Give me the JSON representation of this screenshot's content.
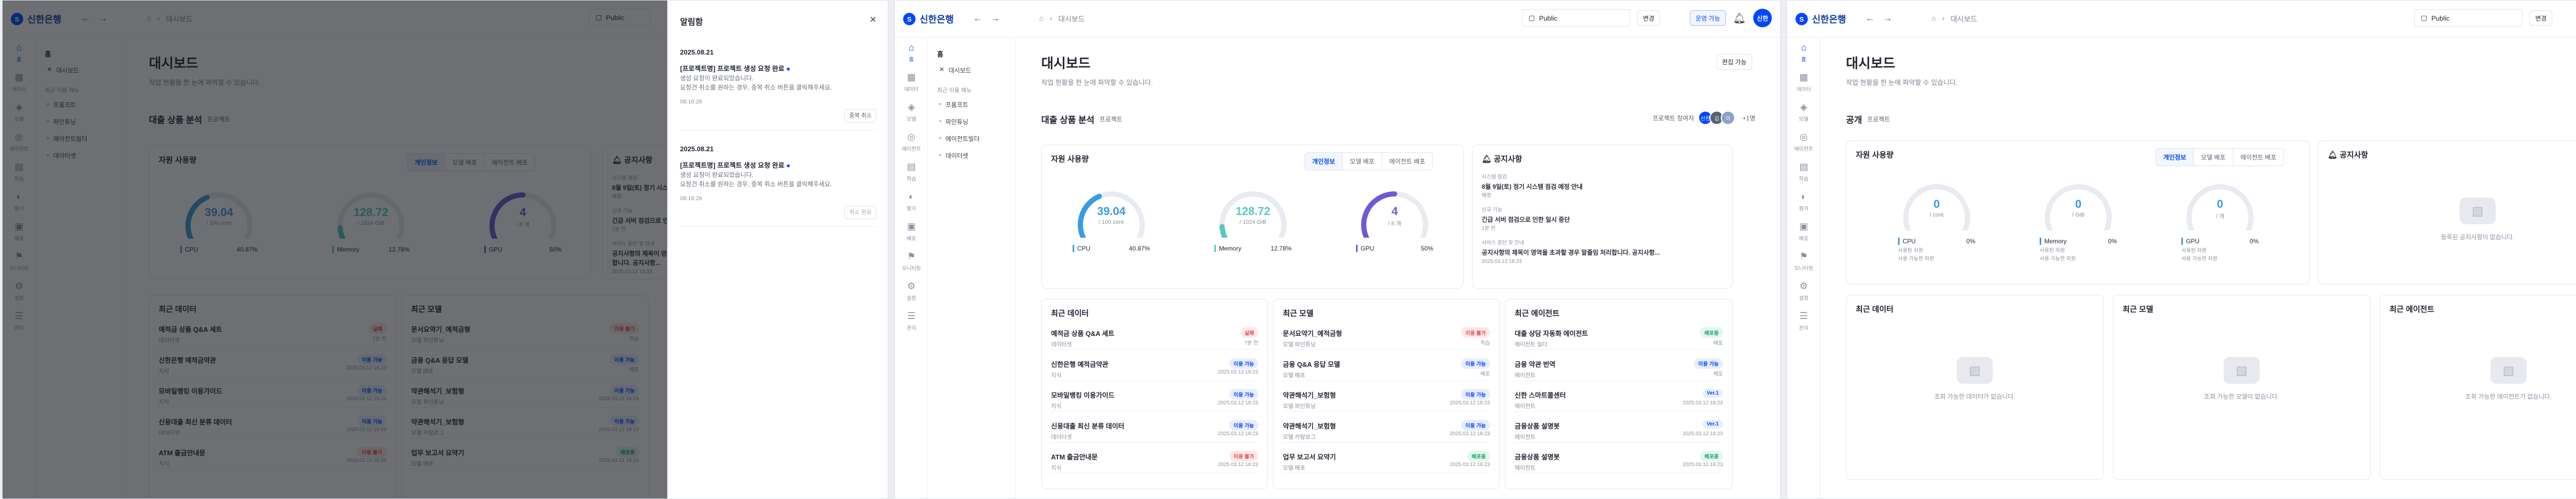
{
  "brand": {
    "name": "신한은행",
    "mark": "S"
  },
  "nav": {
    "back": "←",
    "forward": "→"
  },
  "breadcrumb": [
    "⌂",
    "›",
    "대시보드"
  ],
  "header": {
    "project_select": "Public",
    "tag_button": "변경",
    "mode_badge": "운영 가능",
    "user_initials": "신한"
  },
  "rail": [
    {
      "icon": "⌂",
      "label": "홈"
    },
    {
      "icon": "▦",
      "label": "데이터"
    },
    {
      "icon": "◈",
      "label": "모델"
    },
    {
      "icon": "◎",
      "label": "에이전트"
    },
    {
      "icon": "▤",
      "label": "학습"
    },
    {
      "icon": "◐",
      "label": "평가"
    },
    {
      "icon": "▣",
      "label": "배포"
    },
    {
      "icon": "⚑",
      "label": "모니터링"
    },
    {
      "icon": "⚙",
      "label": "설정"
    },
    {
      "icon": "☰",
      "label": "관리"
    }
  ],
  "submenu": {
    "home": "홈",
    "dashboard": "대시보드",
    "section": "최근 이용 메뉴",
    "items": [
      "프롬프트",
      "파인튜닝",
      "에이전트빌더",
      "데이터셋"
    ]
  },
  "page": {
    "title": "대시보드",
    "subtitle": "작업 현황을 한 눈에 파악할 수 있습니다.",
    "edit_button": "편집 가능",
    "section_title": "대출 상품 분석",
    "section_tag": "프로젝트",
    "section_title_empty": "공개",
    "members_label": "프로젝트 참여자",
    "members_more": "+1명",
    "members": [
      "신한",
      "김",
      "이"
    ]
  },
  "resources": {
    "title": "자원 사용량",
    "tabs": [
      "개인정보",
      "모델 배포",
      "에이전트 배포"
    ],
    "gauges": [
      {
        "name": "CPU",
        "value": "39.04",
        "unit": "/ 100 core",
        "pct": "40.87%",
        "ratio": 0.41,
        "color": "#3a9be0"
      },
      {
        "name": "Memory",
        "value": "128.72",
        "unit": "/ 1024 GiB",
        "pct": "12.78%",
        "ratio": 0.13,
        "color": "#56c8be"
      },
      {
        "name": "GPU",
        "value": "4",
        "unit": "/ 8 개",
        "pct": "50%",
        "ratio": 0.5,
        "color": "#6b5bd6"
      }
    ],
    "gauges_empty": [
      {
        "name": "CPU",
        "value": "0",
        "unit": "/ core",
        "pct": "0%"
      },
      {
        "name": "Memory",
        "value": "0",
        "unit": "/ GiB",
        "pct": "0%"
      },
      {
        "name": "GPU",
        "value": "0",
        "unit": "/ 개",
        "pct": "0%"
      }
    ],
    "sub_used": "사용된 자원",
    "sub_avail": "사용 가능한 자원"
  },
  "notices": {
    "title": "공지사항",
    "items": [
      {
        "section": "시스템 점검",
        "title": "8월 9일(토) 정기 시스템 점검 예정 안내",
        "date": "예정"
      },
      {
        "section": "신규 기능",
        "title": "긴급 서버 점검으로 인한 일시 중단",
        "date": "1분 전"
      },
      {
        "section": "서비스 중단 및 안내",
        "title": "공지사항의 제목이 영역을 초과할 경우 말줄임 처리합니다. 공지사항...",
        "date": "2025.03.12 18:23"
      }
    ],
    "empty": "등록된 공지사항이 없습니다."
  },
  "recent_data": {
    "title": "최근 데이터",
    "items": [
      {
        "name": "예적금 상품 Q&A 세트",
        "sub": "데이터셋",
        "badge": "실패",
        "tone": "red",
        "date": "7분 전"
      },
      {
        "name": "신한은행 예적금약관",
        "sub": "지식",
        "badge": "이용 가능",
        "tone": "blue",
        "date": "2025.03.12 18:23"
      },
      {
        "name": "모바일뱅킹 이용가이드",
        "sub": "지식",
        "badge": "이용 가능",
        "tone": "blue",
        "date": "2025.03.12 18:23"
      },
      {
        "name": "신용대출 최신 분류 데이터",
        "sub": "데이터셋",
        "badge": "이용 가능",
        "tone": "blue",
        "date": "2025.03.12 18:23"
      },
      {
        "name": "ATM 출금안내문",
        "sub": "지식",
        "badge": "이용 불가",
        "tone": "red",
        "date": "2025.03.12 18:23"
      }
    ],
    "empty": "조회 가능한 데이터가 없습니다."
  },
  "recent_models": {
    "title": "최근 모델",
    "items": [
      {
        "name": "문서요약기_예적금형",
        "sub": "모델 파인튜닝",
        "badge": "이용 불가",
        "tone": "red",
        "date": "학습"
      },
      {
        "name": "금융 Q&A 응답 모델",
        "sub": "모델 배포",
        "badge": "이용 가능",
        "tone": "blue",
        "date": "배포"
      },
      {
        "name": "약관해석기_보험형",
        "sub": "모델 파인튜닝",
        "badge": "이용 가능",
        "tone": "blue",
        "date": "2025.03.12 18:23"
      },
      {
        "name": "약관해석기_보험형",
        "sub": "모델 카탈로그",
        "badge": "이용 가능",
        "tone": "blue",
        "date": "2025.03.12 18:23"
      },
      {
        "name": "업무 보고서 요약기",
        "sub": "모델 배포",
        "badge": "배포중",
        "tone": "green",
        "date": "2025.03.12 18:23"
      }
    ],
    "empty": "조회 가능한 모델이 없습니다."
  },
  "recent_agents": {
    "title": "최근 에이전트",
    "items": [
      {
        "name": "대출 상담 자동화 에이전트",
        "sub": "에이전트 빌더",
        "badge": "배포중",
        "tone": "green",
        "date": "배포"
      },
      {
        "name": "금융 약관 번역",
        "sub": "에이전트",
        "badge": "이용 가능",
        "tone": "blue",
        "date": "배포"
      },
      {
        "name": "신한 스마트콜센터",
        "sub": "에이전트",
        "badge": "Ver.1",
        "tone": "blue",
        "date": "2025.03.12 18:23"
      },
      {
        "name": "금융상품 설명봇",
        "sub": "에이전트",
        "badge": "Ver.1",
        "tone": "blue",
        "date": "2025.03.12 18:23"
      },
      {
        "name": "금융상품 설명봇",
        "sub": "에이전트",
        "badge": "배포중",
        "tone": "green",
        "date": "2025.03.12 18:23"
      }
    ],
    "empty": "조회 가능한 에이전트가 없습니다."
  },
  "drawer": {
    "title": "알림함",
    "close": "×",
    "items": [
      {
        "date": "2025.08.21",
        "title": "[프로젝트명] 프로젝트 생성 요청 완료",
        "dot": "●",
        "line1": "생성 요청이 완료되었습니다.",
        "line2": "요청건 취소를 원하는 경우, 중복 취소 버튼을 클릭해주세요.",
        "time": "08:16:26",
        "action": "중복 취소"
      },
      {
        "date": "2025.08.21",
        "title": "[프로젝트명] 프로젝트 생성 요청 완료",
        "dot": "●",
        "line1": "생성 요청이 완료되었습니다.",
        "line2": "요청건 취소를 원하는 경우, 중복 취소 버튼을 클릭해주세요.",
        "time": "08:16:26",
        "action": "취소 완료"
      }
    ]
  }
}
